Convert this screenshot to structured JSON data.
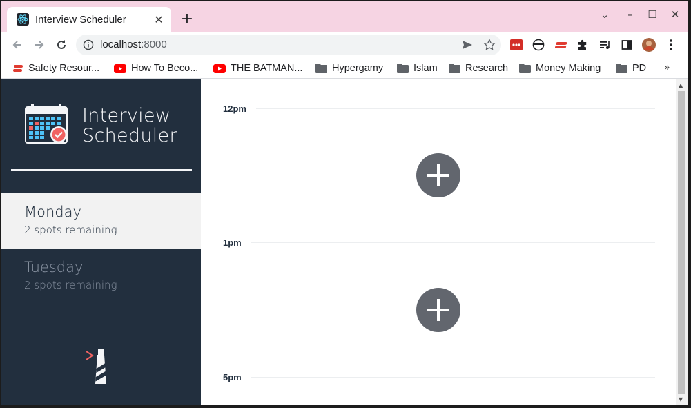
{
  "browser": {
    "tab_title": "Interview Scheduler",
    "tab_close": "✕",
    "new_tab": "+",
    "window_controls": [
      "⌄",
      "–",
      "☐",
      "✕"
    ],
    "url_host": "localhost",
    "url_port": ":8000",
    "bookmarks": [
      {
        "label": "Safety Resour...",
        "icon": "ext-red-icon"
      },
      {
        "label": "How To Beco...",
        "icon": "youtube-icon"
      },
      {
        "label": "THE BATMAN...",
        "icon": "youtube-icon"
      },
      {
        "label": "Hypergamy",
        "icon": "folder-icon"
      },
      {
        "label": "Islam",
        "icon": "folder-icon"
      },
      {
        "label": "Research",
        "icon": "folder-icon"
      },
      {
        "label": "Money Making",
        "icon": "folder-icon"
      },
      {
        "label": "PD",
        "icon": "folder-icon"
      }
    ],
    "bookmarks_more": "»",
    "colors": {
      "tabstrip": "#f6d4e3",
      "omnibox": "#f1f3f4"
    }
  },
  "app": {
    "brand_line1": "Interview",
    "brand_line2": "Scheduler",
    "days": [
      {
        "name": "Monday",
        "spots": "2 spots remaining",
        "selected": true
      },
      {
        "name": "Tuesday",
        "spots": "2 spots remaining",
        "selected": false
      }
    ],
    "slots": [
      {
        "time": "12pm"
      },
      {
        "time": "1pm"
      },
      {
        "time": "5pm"
      }
    ],
    "colors": {
      "sidebar": "#222f3e",
      "selected_day": "#f2f2f2",
      "add_button": "#62666e"
    }
  }
}
